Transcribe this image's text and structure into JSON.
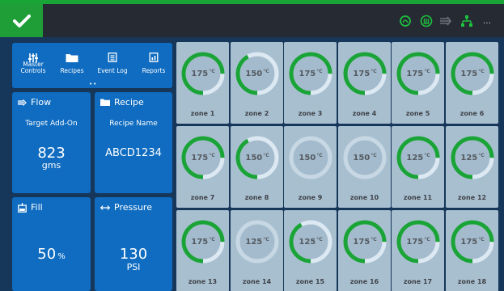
{
  "colors": {
    "accent_green": "#1aa337",
    "panel_blue": "#0f6cc0",
    "background": "#16365a",
    "zone_bg": "#a8bfd0",
    "ring_track": "#dde9f2",
    "ring_track_full": "#c7d8e4",
    "ring_progress": "#1aa337"
  },
  "topbar": {
    "status_icons": [
      "heater-icon",
      "temperature-icon",
      "flow-icon",
      "network-icon"
    ],
    "more_label": "…"
  },
  "nav": [
    {
      "label": "Master Controls",
      "line1": "Master",
      "line2": "Controls",
      "icon": "sliders-icon"
    },
    {
      "label": "Recipes",
      "icon": "folder-icon"
    },
    {
      "label": "Event Log",
      "icon": "list-icon"
    },
    {
      "label": "Reports",
      "icon": "report-icon"
    }
  ],
  "nav_dots": "••",
  "flow_card": {
    "title": "Flow",
    "subtitle": "Target Add-On",
    "value": "823",
    "unit": "gms"
  },
  "recipe_card": {
    "title": "Recipe",
    "subtitle": "Recipe Name",
    "value": "ABCD1234"
  },
  "fill_card": {
    "title": "Fill",
    "value": "50",
    "unit": "%"
  },
  "pressure_card": {
    "title": "Pressure",
    "value": "130",
    "unit": "PSI"
  },
  "temp_unit": "°C",
  "zones": [
    {
      "name": "zone 1",
      "temp": "175",
      "level": 0.75
    },
    {
      "name": "zone 2",
      "temp": "150",
      "level": 0.42
    },
    {
      "name": "zone 3",
      "temp": "175",
      "level": 0.75
    },
    {
      "name": "zone 4",
      "temp": "175",
      "level": 0.75
    },
    {
      "name": "zone 5",
      "temp": "175",
      "level": 0.75
    },
    {
      "name": "zone 6",
      "temp": "175",
      "level": 0.75
    },
    {
      "name": "zone 7",
      "temp": "175",
      "level": 0.75
    },
    {
      "name": "zone 8",
      "temp": "150",
      "level": 0.42
    },
    {
      "name": "zone 9",
      "temp": "150",
      "level": 0.0
    },
    {
      "name": "zone 10",
      "temp": "150",
      "level": 0.0
    },
    {
      "name": "zone 11",
      "temp": "125",
      "level": 0.75
    },
    {
      "name": "zone 12",
      "temp": "125",
      "level": 0.75
    },
    {
      "name": "zone 13",
      "temp": "175",
      "level": 0.75
    },
    {
      "name": "zone 14",
      "temp": "125",
      "level": 0.0
    },
    {
      "name": "zone 15",
      "temp": "125",
      "level": 0.42
    },
    {
      "name": "zone 16",
      "temp": "175",
      "level": 0.75
    },
    {
      "name": "zone 17",
      "temp": "175",
      "level": 0.75
    },
    {
      "name": "zone 18",
      "temp": "175",
      "level": 0.75
    }
  ]
}
